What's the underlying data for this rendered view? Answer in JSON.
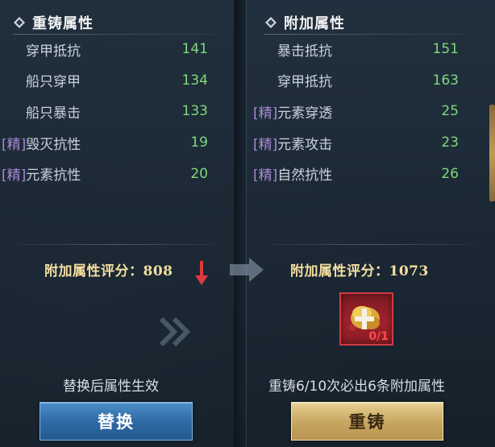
{
  "left_panel": {
    "title": "重铸属性",
    "attributes": [
      {
        "tag": "",
        "name": "穿甲抵抗",
        "value": "141"
      },
      {
        "tag": "",
        "name": "船只穿甲",
        "value": "134"
      },
      {
        "tag": "",
        "name": "船只暴击",
        "value": "133"
      },
      {
        "tag": "[精]",
        "name": "毁灭抗性",
        "value": "19"
      },
      {
        "tag": "[精]",
        "name": "元素抗性",
        "value": "20"
      }
    ],
    "score_text": "附加属性评分：808",
    "hint": "替换后属性生效",
    "button_label": "替换"
  },
  "right_panel": {
    "title": "附加属性",
    "attributes": [
      {
        "tag": "",
        "name": "暴击抵抗",
        "value": "151"
      },
      {
        "tag": "",
        "name": "穿甲抵抗",
        "value": "163"
      },
      {
        "tag": "[精]",
        "name": "元素穿透",
        "value": "25"
      },
      {
        "tag": "[精]",
        "name": "元素攻击",
        "value": "23"
      },
      {
        "tag": "[精]",
        "name": "自然抗性",
        "value": "26"
      }
    ],
    "score_text": "附加属性评分：1073",
    "item": {
      "icon": "reforge-material-icon",
      "count": "0/1"
    },
    "hint": "重铸6/10次必出6条附加属性",
    "button_label": "重铸"
  },
  "colors": {
    "value_green": "#7fd97a",
    "refined_tag_purple": "#a78ad6",
    "score_gold": "#f3dfa0",
    "down_arrow_red": "#e0383e",
    "replace_button_blue": "#2f6aa6",
    "reforge_button_gold": "#c9a862"
  }
}
